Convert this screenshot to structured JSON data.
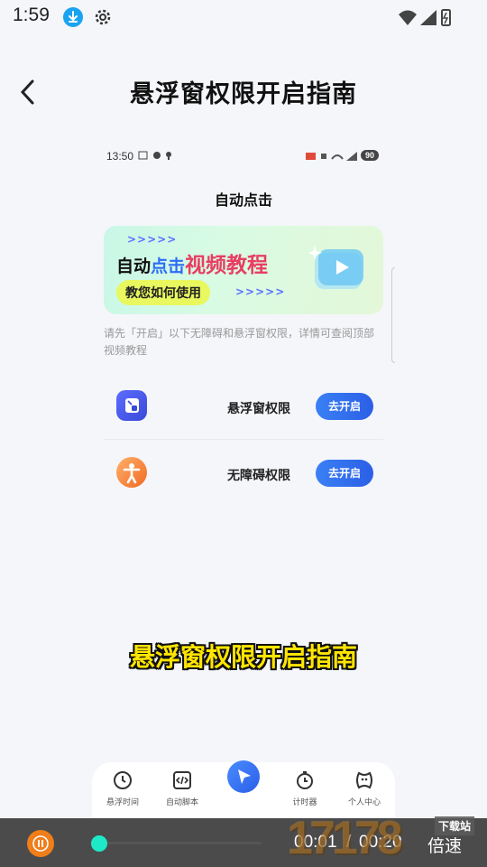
{
  "status_bar": {
    "time": "1:59"
  },
  "header": {
    "title": "悬浮窗权限开启指南"
  },
  "demo": {
    "status_time": "13:50",
    "battery": "90",
    "title": "自动点击",
    "banner": {
      "line_part1": "自动",
      "line_part2": "点击",
      "line_part3": "视频教程",
      "pill": "教您如何使用",
      "arrows": ">>>>>"
    },
    "hint": "请先「开启」以下无障碍和悬浮窗权限，详情可查阅顶部视频教程",
    "permissions": [
      {
        "label": "悬浮窗权限",
        "button": "去开启",
        "icon": "floating-window-icon"
      },
      {
        "label": "无障碍权限",
        "button": "去开启",
        "icon": "accessibility-icon"
      }
    ],
    "nav": [
      {
        "label": "悬浮时间",
        "icon": "clock-icon"
      },
      {
        "label": "自动脚本",
        "icon": "code-icon"
      },
      {
        "label": "",
        "icon": "cursor-icon"
      },
      {
        "label": "计时器",
        "icon": "timer-icon"
      },
      {
        "label": "个人中心",
        "icon": "profile-icon"
      }
    ]
  },
  "subtitle": "悬浮窗权限开启指南",
  "player": {
    "current": "00:01",
    "separator": "/",
    "total": "00:20",
    "speed": "倍速",
    "progress": 0.05
  },
  "watermark": {
    "text": "17178",
    "tag": "下载站"
  },
  "colors": {
    "accent": "#2e6cf6",
    "subtitle": "#ffe500",
    "seek": "#1de9c9",
    "pause": "#f07e1a"
  }
}
